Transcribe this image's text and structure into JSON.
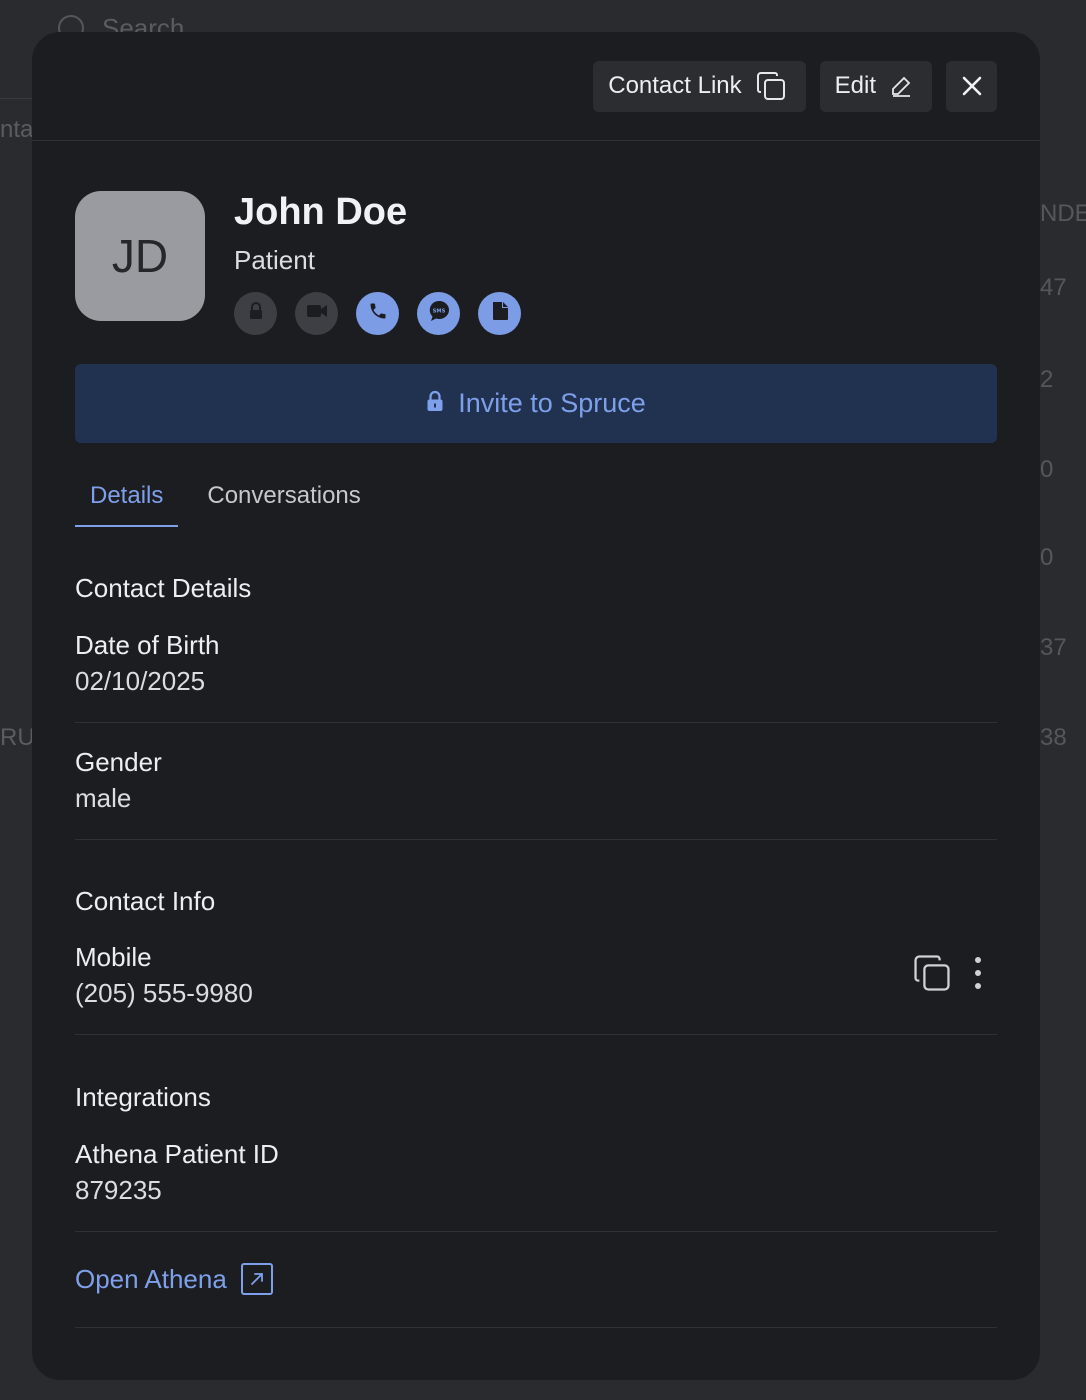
{
  "background": {
    "search_placeholder": "Search",
    "left_fragments": [
      "nta",
      "RU"
    ],
    "right_fragments": [
      "NDE",
      "47",
      "2",
      "0",
      "0",
      "37",
      "38"
    ]
  },
  "header": {
    "contact_link_label": "Contact Link",
    "edit_label": "Edit"
  },
  "profile": {
    "initials": "JD",
    "name": "John Doe",
    "role": "Patient"
  },
  "invite": {
    "label": "Invite to Spruce"
  },
  "tabs": [
    {
      "label": "Details",
      "active": true
    },
    {
      "label": "Conversations",
      "active": false
    }
  ],
  "contact_details": {
    "title": "Contact Details",
    "dob_label": "Date of Birth",
    "dob_value": "02/10/2025",
    "gender_label": "Gender",
    "gender_value": "male"
  },
  "contact_info": {
    "title": "Contact Info",
    "mobile_label": "Mobile",
    "mobile_value": "(205) 555-9980"
  },
  "integrations": {
    "title": "Integrations",
    "athena_label": "Athena Patient ID",
    "athena_value": "879235",
    "open_label": "Open Athena"
  },
  "colors": {
    "accent": "#7ea0ea",
    "modal_bg": "#1c1d20",
    "invite_bg": "#213150"
  }
}
